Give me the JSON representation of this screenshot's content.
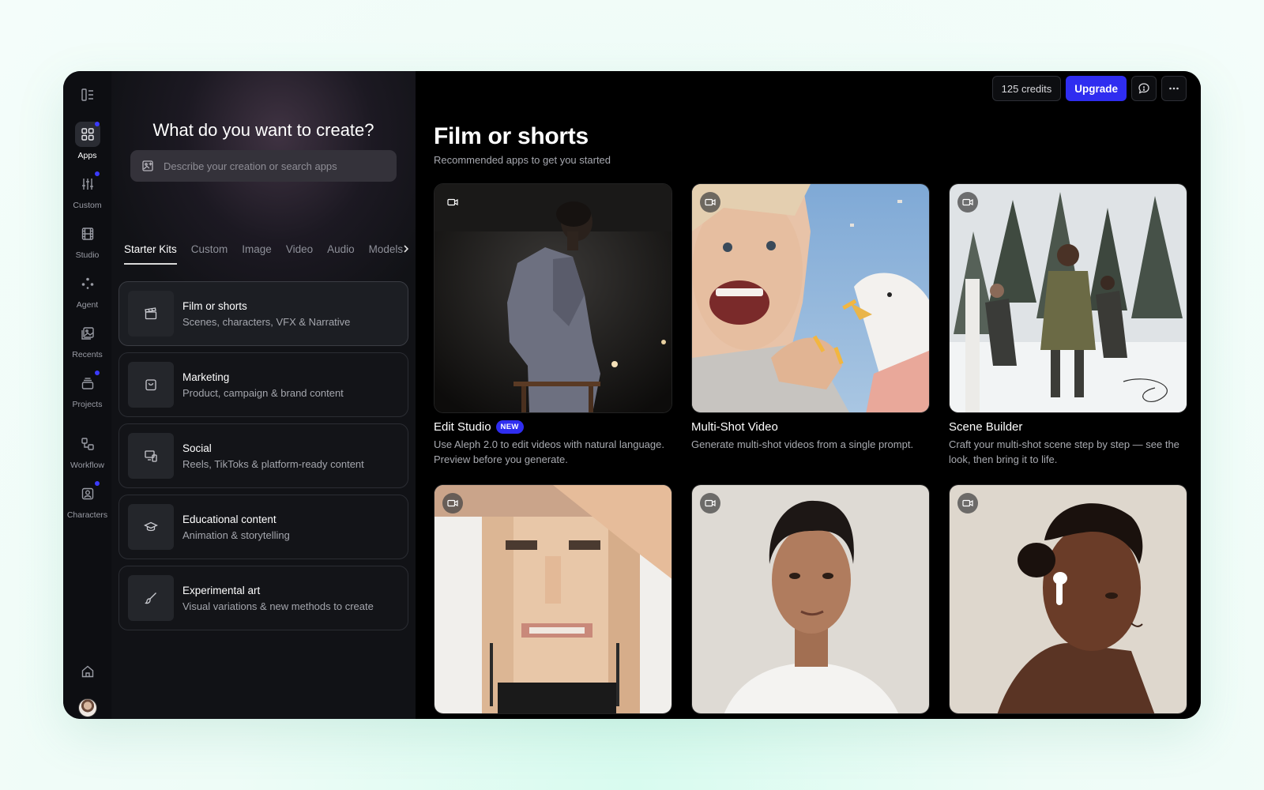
{
  "rail": {
    "items": [
      {
        "label": "Apps",
        "icon": "apps-grid-icon",
        "active": true,
        "dot": true
      },
      {
        "label": "Custom",
        "icon": "sliders-icon",
        "active": false,
        "dot": true
      },
      {
        "label": "Studio",
        "icon": "film-icon",
        "active": false,
        "dot": false
      },
      {
        "label": "Agent",
        "icon": "sparkle-dots-icon",
        "active": false,
        "dot": false
      },
      {
        "label": "Recents",
        "icon": "image-stack-icon",
        "active": false,
        "dot": false
      },
      {
        "label": "Projects",
        "icon": "layers-icon",
        "active": false,
        "dot": true
      },
      {
        "label": "Workflow",
        "icon": "workflow-icon",
        "active": false,
        "dot": false
      },
      {
        "label": "Characters",
        "icon": "character-icon",
        "active": false,
        "dot": true
      }
    ]
  },
  "panel": {
    "title": "What do you want to create?",
    "search_placeholder": "Describe your creation or search apps",
    "tabs": [
      "Starter Kits",
      "Custom",
      "Image",
      "Video",
      "Audio",
      "Models"
    ],
    "kits": [
      {
        "title": "Film or shorts",
        "subtitle": "Scenes, characters, VFX & Narrative",
        "icon": "clapperboard-icon"
      },
      {
        "title": "Marketing",
        "subtitle": "Product, campaign & brand content",
        "icon": "shopping-bag-icon"
      },
      {
        "title": "Social",
        "subtitle": "Reels, TikToks & platform-ready content",
        "icon": "devices-icon"
      },
      {
        "title": "Educational content",
        "subtitle": "Animation & storytelling",
        "icon": "graduation-cap-icon"
      },
      {
        "title": "Experimental art",
        "subtitle": "Visual variations & new methods to create",
        "icon": "brush-icon"
      }
    ]
  },
  "topbar": {
    "credits": "125 credits",
    "upgrade": "Upgrade"
  },
  "main": {
    "title": "Film or shorts",
    "subtitle": "Recommended apps to get you started",
    "cards": [
      {
        "title": "Edit Studio",
        "badge": "NEW",
        "desc": "Use Aleph 2.0 to edit videos with natural language. Preview before you generate."
      },
      {
        "title": "Multi-Shot Video",
        "desc": "Generate multi-shot videos from a single prompt."
      },
      {
        "title": "Scene Builder",
        "desc": "Craft your multi-shot scene step by step — see the look, then bring it to life."
      },
      {
        "title": "",
        "desc": ""
      },
      {
        "title": "",
        "desc": ""
      },
      {
        "title": "",
        "desc": ""
      }
    ]
  },
  "colors": {
    "accent": "#2f2df0",
    "background": "#000000",
    "panel": "#111216"
  }
}
